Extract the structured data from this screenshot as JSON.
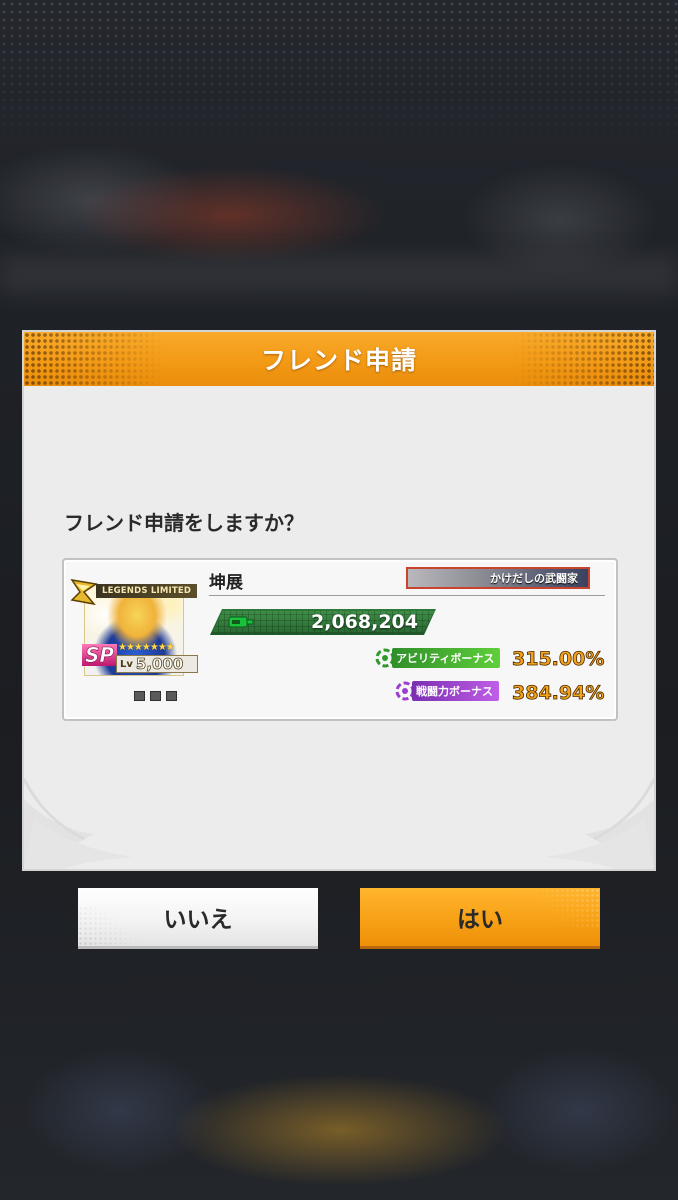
{
  "dialog": {
    "title": "フレンド申請",
    "prompt": "フレンド申請をしますか？"
  },
  "friend": {
    "name": "坤展",
    "player_title": "かけだしの武闘家",
    "battle_power": "2,068,204",
    "character": {
      "tag": "LEGENDS LIMITED",
      "rarity": "SP",
      "stars": "★★★★★★★",
      "level_label": "Lv",
      "level": "5,000",
      "equipment_slots": 3
    },
    "bonuses": [
      {
        "label": "アビリティボーナス",
        "value": "315.00%",
        "color": "#4ab832"
      },
      {
        "label": "戦闘力ボーナス",
        "value": "384.94%",
        "color": "#a34fd6"
      }
    ]
  },
  "buttons": {
    "no_label": "いいえ",
    "yes_label": "はい"
  },
  "colors": {
    "accent": "#f39a16",
    "dialog_bg": "#ececec",
    "power_bar": "#2e7a3a"
  }
}
